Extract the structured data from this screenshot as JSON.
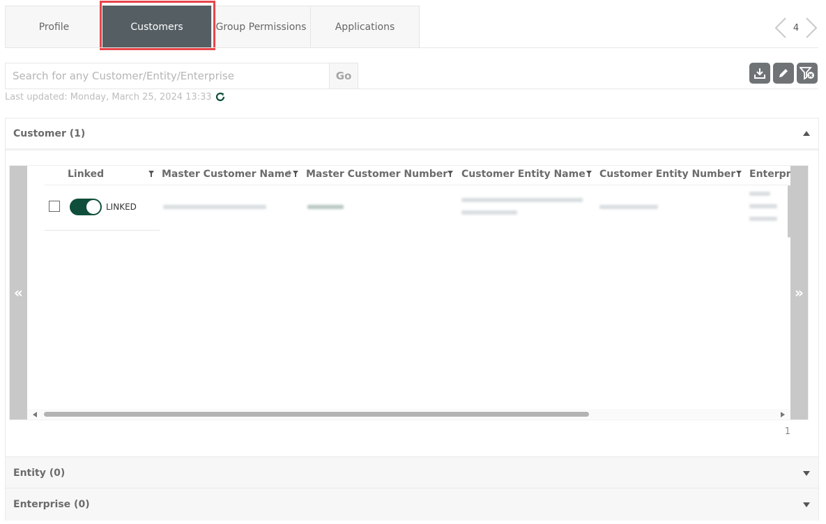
{
  "tabs": [
    {
      "label": "Profile"
    },
    {
      "label": "Customers"
    },
    {
      "label": "Group Permissions"
    },
    {
      "label": "Applications"
    }
  ],
  "pager": {
    "count": "4"
  },
  "search": {
    "placeholder": "Search for any Customer/Entity/Enterprise",
    "go_label": "Go"
  },
  "last_updated": "Last updated: Monday, March 25, 2024 13:33",
  "sections": [
    {
      "title": "Customer (1)"
    },
    {
      "title": "Entity (0)"
    },
    {
      "title": "Enterprise (0)"
    }
  ],
  "grid": {
    "columns": [
      "Linked",
      "Master Customer Name",
      "Master Customer Number",
      "Customer Entity Name",
      "Customer Entity Number",
      "Enterpr"
    ],
    "rows": [
      {
        "linked_label": "LINKED"
      }
    ],
    "row_count": "1"
  },
  "colors": {
    "accent": "#0f4e3b",
    "active_tab": "#545e63",
    "highlight": "#e84549"
  }
}
